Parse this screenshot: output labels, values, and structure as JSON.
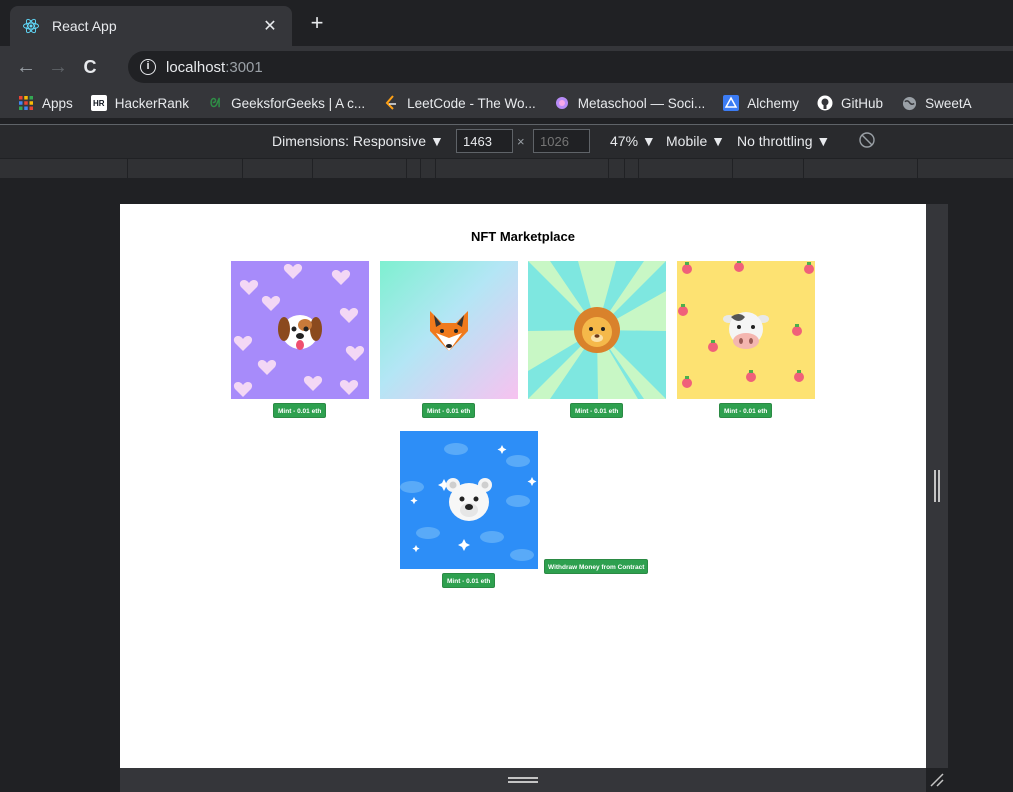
{
  "browser": {
    "tab_title": "React App",
    "tab_close": "✕",
    "new_tab": "+",
    "url_host": "localhost",
    "url_port": ":3001"
  },
  "bookmarks": [
    {
      "label": "Apps",
      "icon": "apps-grid-icon"
    },
    {
      "label": "HackerRank",
      "icon": "hackerrank-icon",
      "badge": "HR"
    },
    {
      "label": "GeeksforGeeks | A c...",
      "icon": "geeksforgeeks-icon"
    },
    {
      "label": "LeetCode - The Wo...",
      "icon": "leetcode-icon"
    },
    {
      "label": "Metaschool — Soci...",
      "icon": "metaschool-icon"
    },
    {
      "label": "Alchemy",
      "icon": "alchemy-icon"
    },
    {
      "label": "GitHub",
      "icon": "github-icon"
    },
    {
      "label": "SweetA",
      "icon": "globe-icon"
    }
  ],
  "devtools": {
    "dimensions_label": "Dimensions: Responsive ▼",
    "width": "1463",
    "height_placeholder": "1026",
    "times": "×",
    "zoom": "47% ▼",
    "device_type": "Mobile ▼",
    "throttling": "No throttling ▼"
  },
  "app": {
    "title": "NFT Marketplace",
    "nfts": [
      {
        "name": "dog",
        "mint_label": "Mint - 0.01 eth",
        "bg": "#a78bfa"
      },
      {
        "name": "fox",
        "mint_label": "Mint - 0.01 eth",
        "bg": "gradient-mint-pink"
      },
      {
        "name": "lion",
        "mint_label": "Mint - 0.01 eth",
        "bg": "sunburst-cyan"
      },
      {
        "name": "cow",
        "mint_label": "Mint - 0.01 eth",
        "bg": "#fde272"
      },
      {
        "name": "polar-bear",
        "mint_label": "Mint - 0.01 eth",
        "bg": "#2d8ef7"
      }
    ],
    "withdraw_label": "Withdraw Money from Contract"
  },
  "colors": {
    "button_green": "#2ea04f",
    "chrome_dark": "#35363a"
  }
}
